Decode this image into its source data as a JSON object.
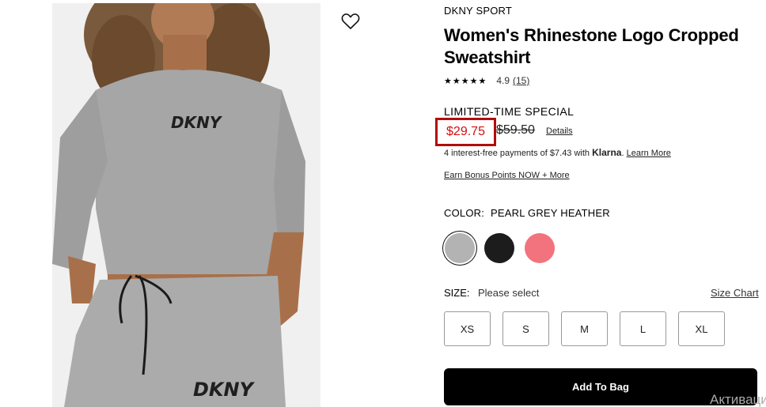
{
  "product": {
    "brand": "DKNY SPORT",
    "title": "Women's Rhinestone Logo Cropped Sweatshirt",
    "image_logo_text": "DKNY",
    "rating": {
      "stars": "★★★★★",
      "value": "4.9",
      "count": "(15)"
    },
    "pricing": {
      "promo_label": "LIMITED-TIME SPECIAL",
      "sale_price": "$29.75",
      "original_price": "$59.50",
      "details_link": "Details",
      "accent_color": "#d40f0f",
      "highlight_color": "#b30c0c"
    },
    "klarna": {
      "text": "4 interest-free payments of $7.43 with ",
      "brand": "Klarna",
      "separator": ". ",
      "learn_more": "Learn More"
    },
    "bonus_link": "Earn Bonus Points NOW + More",
    "color": {
      "label": "COLOR:",
      "selected": "PEARL GREY HEATHER",
      "swatches": [
        {
          "name": "pearl-grey-heather",
          "hex": "#b3b3b3",
          "selected": true
        },
        {
          "name": "black",
          "hex": "#1c1c1c",
          "selected": false
        },
        {
          "name": "pink",
          "hex": "#f2737d",
          "selected": false
        }
      ]
    },
    "size": {
      "label": "SIZE:",
      "prompt": "Please select",
      "chart_link": "Size Chart",
      "options": [
        "XS",
        "S",
        "M",
        "L",
        "XL"
      ]
    },
    "add_to_bag": "Add To Bag"
  },
  "overlay": {
    "watermark": "Активация"
  }
}
